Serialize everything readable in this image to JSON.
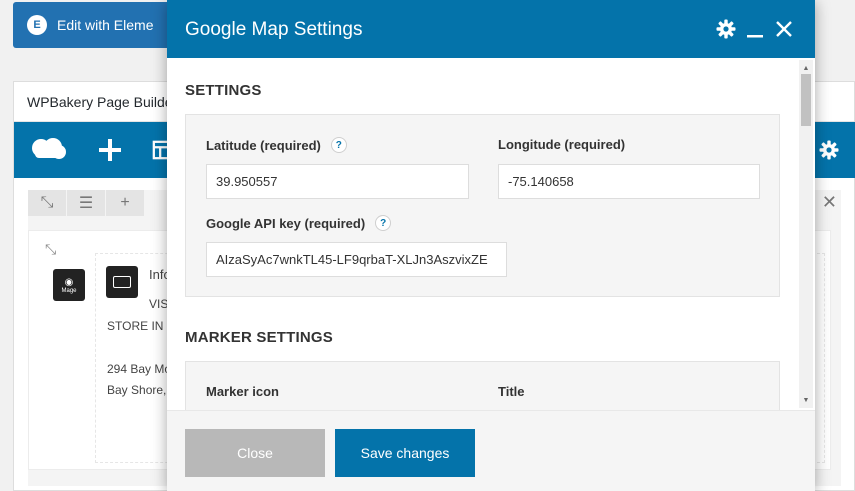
{
  "background": {
    "elementor_button": "Edit with Eleme",
    "wpb_title": "WPBakery Page Builde",
    "element_info_title": "Info",
    "map_icon_label": "Mage",
    "text_visi": "VISI",
    "text_store": "STORE IN N",
    "text_address1": "294 Bay Mo",
    "text_address2": "Bay Shore,"
  },
  "modal": {
    "title": "Google Map Settings",
    "settings_section": "SETTINGS",
    "latitude_label": "Latitude (required)",
    "latitude_value": "39.950557",
    "longitude_label": "Longitude (required)",
    "longitude_value": "-75.140658",
    "api_key_label": "Google API key (required)",
    "api_key_value": "AIzaSyAc7wnkTL45-LF9qrbaT-XLJn3AszvixZE",
    "help_glyph": "?",
    "marker_section": "MARKER SETTINGS",
    "marker_icon_label": "Marker icon",
    "title_label": "Title",
    "close_button": "Close",
    "save_button": "Save changes"
  },
  "colors": {
    "primary": "#0473aa",
    "close_button": "#b8b8b8",
    "panel_bg": "#f5f5f5"
  },
  "icons": {
    "header": [
      "gear-icon",
      "minimize-icon",
      "close-icon"
    ],
    "toolbar": [
      "cloud-icon",
      "plus-icon",
      "layout-icon",
      "gear-icon"
    ]
  }
}
